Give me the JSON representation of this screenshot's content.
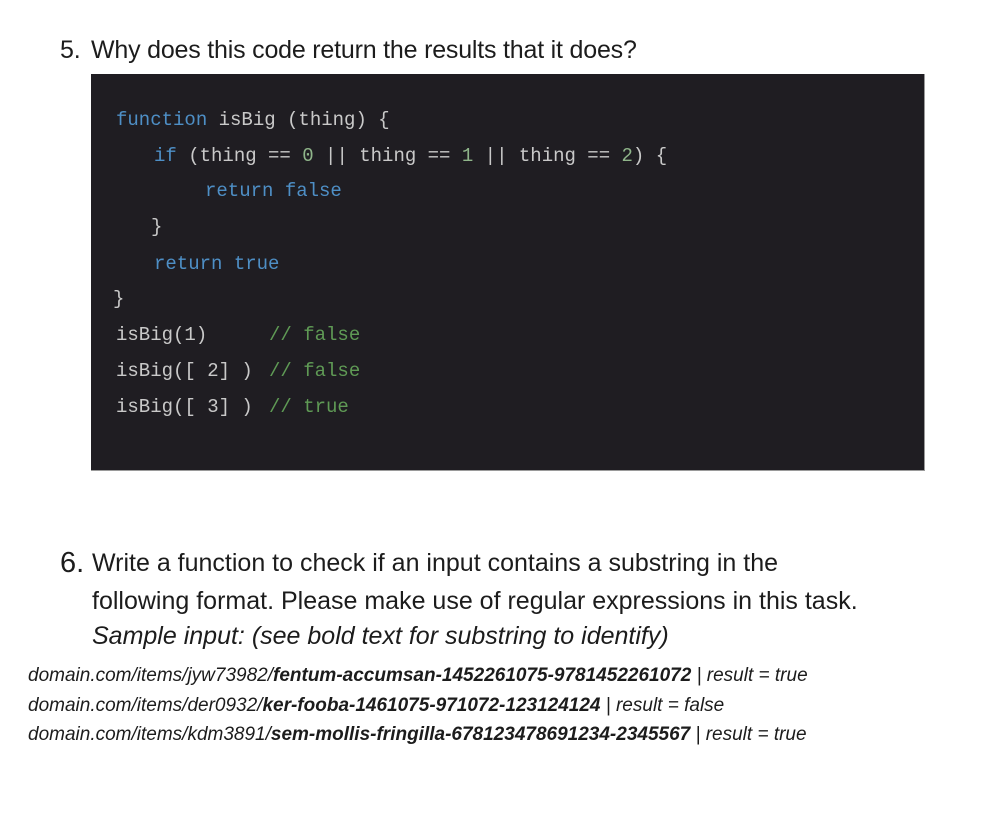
{
  "question5": {
    "number": "5.",
    "text": "Why does this code return the results that it does?",
    "code": {
      "lines": [
        {
          "kw1": "function",
          "rest": " isBig (thing) {"
        },
        {
          "kw1": "if",
          "p1": " (thing == ",
          "n1": "0",
          "p2": " || thing == ",
          "n2": "1",
          "p3": " || thing == ",
          "n3": "2",
          "p4": ") {"
        },
        {
          "kw1": "return false"
        },
        {
          "rest": "}"
        },
        {
          "kw1": "return true"
        },
        {
          "rest": "}"
        },
        {
          "call": "isBig(1)",
          "comment": "// false"
        },
        {
          "call": "isBig([ 2] )",
          "comment": "// false"
        },
        {
          "call": "isBig([ 3] )",
          "comment": "// true"
        }
      ]
    }
  },
  "question6": {
    "number": "6.",
    "lines": [
      "Write a function to check if an input contains a substring in the",
      "following format. Please make use of regular expressions in this task."
    ],
    "sample_label": "Sample input: (see bold text for substring to identify)",
    "samples": [
      {
        "prefix": "domain.com/items/jyw73982/",
        "bold": "fentum-accumsan-1452261075-9781452261072",
        "suffix": " | result = true"
      },
      {
        "prefix": "domain.com/items/der0932/",
        "bold": "ker-fooba-1461075-971072-123124124",
        "suffix": " | result = false"
      },
      {
        "prefix": "domain.com/items/kdm3891/",
        "bold": "sem-mollis-fringilla-678123478691234-2345567",
        "suffix": " | result = true"
      }
    ]
  }
}
